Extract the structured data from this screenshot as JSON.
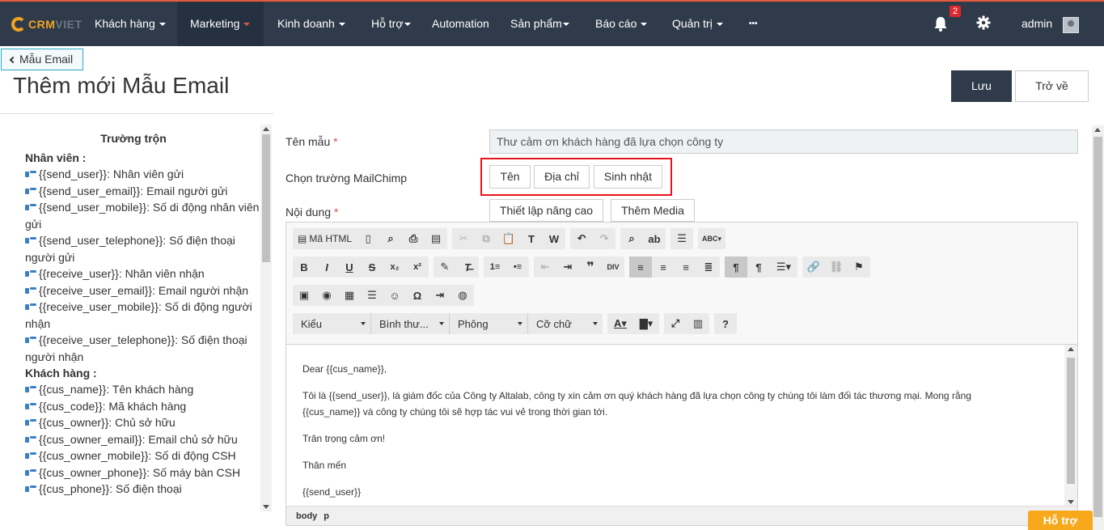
{
  "nav": {
    "logo_part1": "CRM",
    "logo_part2": "VIET",
    "items": [
      {
        "label": "Khách hàng"
      },
      {
        "label": "Marketing"
      },
      {
        "label": "Kinh doanh"
      },
      {
        "label": "Hỗ trợ"
      },
      {
        "label": "Automation"
      },
      {
        "label": "Sản phẩm"
      },
      {
        "label": "Báo cáo"
      },
      {
        "label": "Quản trị"
      },
      {
        "label": "•••"
      }
    ],
    "notification_count": "2",
    "user": "admin",
    "accent_color": "#e55a3c",
    "bg_color": "#2f3b4a"
  },
  "header": {
    "back_label": "Mẫu Email",
    "title": "Thêm mới Mẫu Email",
    "save_label": "Lưu",
    "return_label": "Trở về"
  },
  "merge_fields": {
    "title": "Trường trộn",
    "groups": [
      {
        "title": "Nhân viên :",
        "items": [
          "{{send_user}}: Nhân viên gửi",
          "{{send_user_email}}: Email người gửi",
          "{{send_user_mobile}}: Số di động nhân viên gửi",
          "{{send_user_telephone}}: Số điện thoại người gửi",
          "{{receive_user}}: Nhân viên nhận",
          "{{receive_user_email}}: Email người nhận",
          "{{receive_user_mobile}}: Số di động người nhận",
          "{{receive_user_telephone}}: Số điện thoại người nhận"
        ]
      },
      {
        "title": "Khách hàng :",
        "items": [
          "{{cus_name}}: Tên khách hàng",
          "{{cus_code}}: Mã khách hàng",
          "{{cus_owner}}: Chủ sở hữu",
          "{{cus_owner_email}}: Email chủ sở hữu",
          "{{cus_owner_mobile}}: Số di động CSH",
          "{{cus_owner_phone}}: Số máy bàn CSH",
          "{{cus_phone}}: Số điện thoại"
        ]
      }
    ]
  },
  "form": {
    "name_label": "Tên mẫu",
    "name_value": "Thư cảm ơn khách hàng đã lựa chọn công ty",
    "mailchimp_label": "Chọn trường MailChimp",
    "mailchimp_buttons": [
      "Tên",
      "Địa chỉ",
      "Sinh nhật"
    ],
    "content_label": "Nội dung",
    "advanced_label": "Thiết lập nâng cao",
    "media_label": "Thêm Media",
    "required_mark": "*"
  },
  "editor": {
    "source_label": "Mã HTML",
    "combos": [
      "Kiểu",
      "Bình thư...",
      "Phông",
      "Cỡ chữ"
    ],
    "help_label": "?",
    "paragraphs": [
      "Dear {{cus_name}},",
      "Tôi là {{send_user}}, là giám đốc của Công ty Altalab, công ty xin cảm ơn quý khách hàng đã lựa chọn công ty chúng tôi làm đối tác thương mại. Mong rằng {{cus_name}} và công ty chúng tôi sẽ hợp tác vui vẻ trong thời gian tới.",
      "Trân trọng cảm ơn!",
      "Thân mến",
      "{{send_user}}"
    ],
    "path": [
      "body",
      "p"
    ]
  },
  "help_tab": "Hỗ trợ"
}
